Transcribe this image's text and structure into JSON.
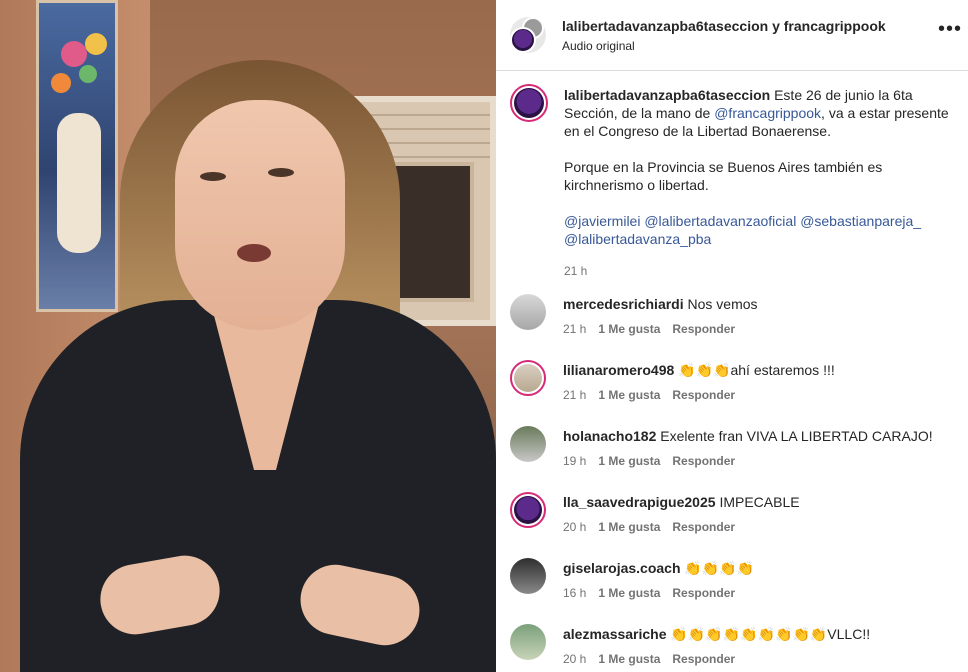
{
  "header": {
    "username_line": "lalibertadavanzapba6taseccion y francagrippook",
    "audio": "Audio original",
    "more_icon": "more-horizontal-icon"
  },
  "caption": {
    "username": "lalibertadavanzapba6taseccion",
    "text_a": " Este 26 de junio la 6ta Sección, de la mano de ",
    "mention": "@francagrippook",
    "text_b": ", va a estar presente en el Congreso de la Libertad Bonaerense.",
    "paragraph2": "Porque en la Provincia se Buenos Aires también es kirchnerismo o libertad.",
    "tags": "@javiermilei @lalibertadavanzaoficial @sebastianpareja_ @lalibertadavanza_pba",
    "time": "21 h"
  },
  "actions": {
    "like": "1 Me gusta",
    "reply": "Responder"
  },
  "comments": [
    {
      "user": "mercedesrichiardi",
      "text": "Nos vemos",
      "time": "21 h"
    },
    {
      "user": "lilianaromero498",
      "text": "👏👏👏ahí estaremos !!!",
      "time": "21 h"
    },
    {
      "user": "holanacho182",
      "text": "Exelente fran VIVA LA LIBERTAD CARAJO!",
      "time": "19 h"
    },
    {
      "user": "lla_saavedrapigue2025",
      "text": "IMPECABLE",
      "time": "20 h"
    },
    {
      "user": "giselarojas.coach",
      "text": "👏👏👏👏",
      "time": "16 h"
    },
    {
      "user": "alezmassariche",
      "text": "👏👏👏👏👏👏👏👏👏VLLC!!",
      "time": "20 h"
    }
  ]
}
